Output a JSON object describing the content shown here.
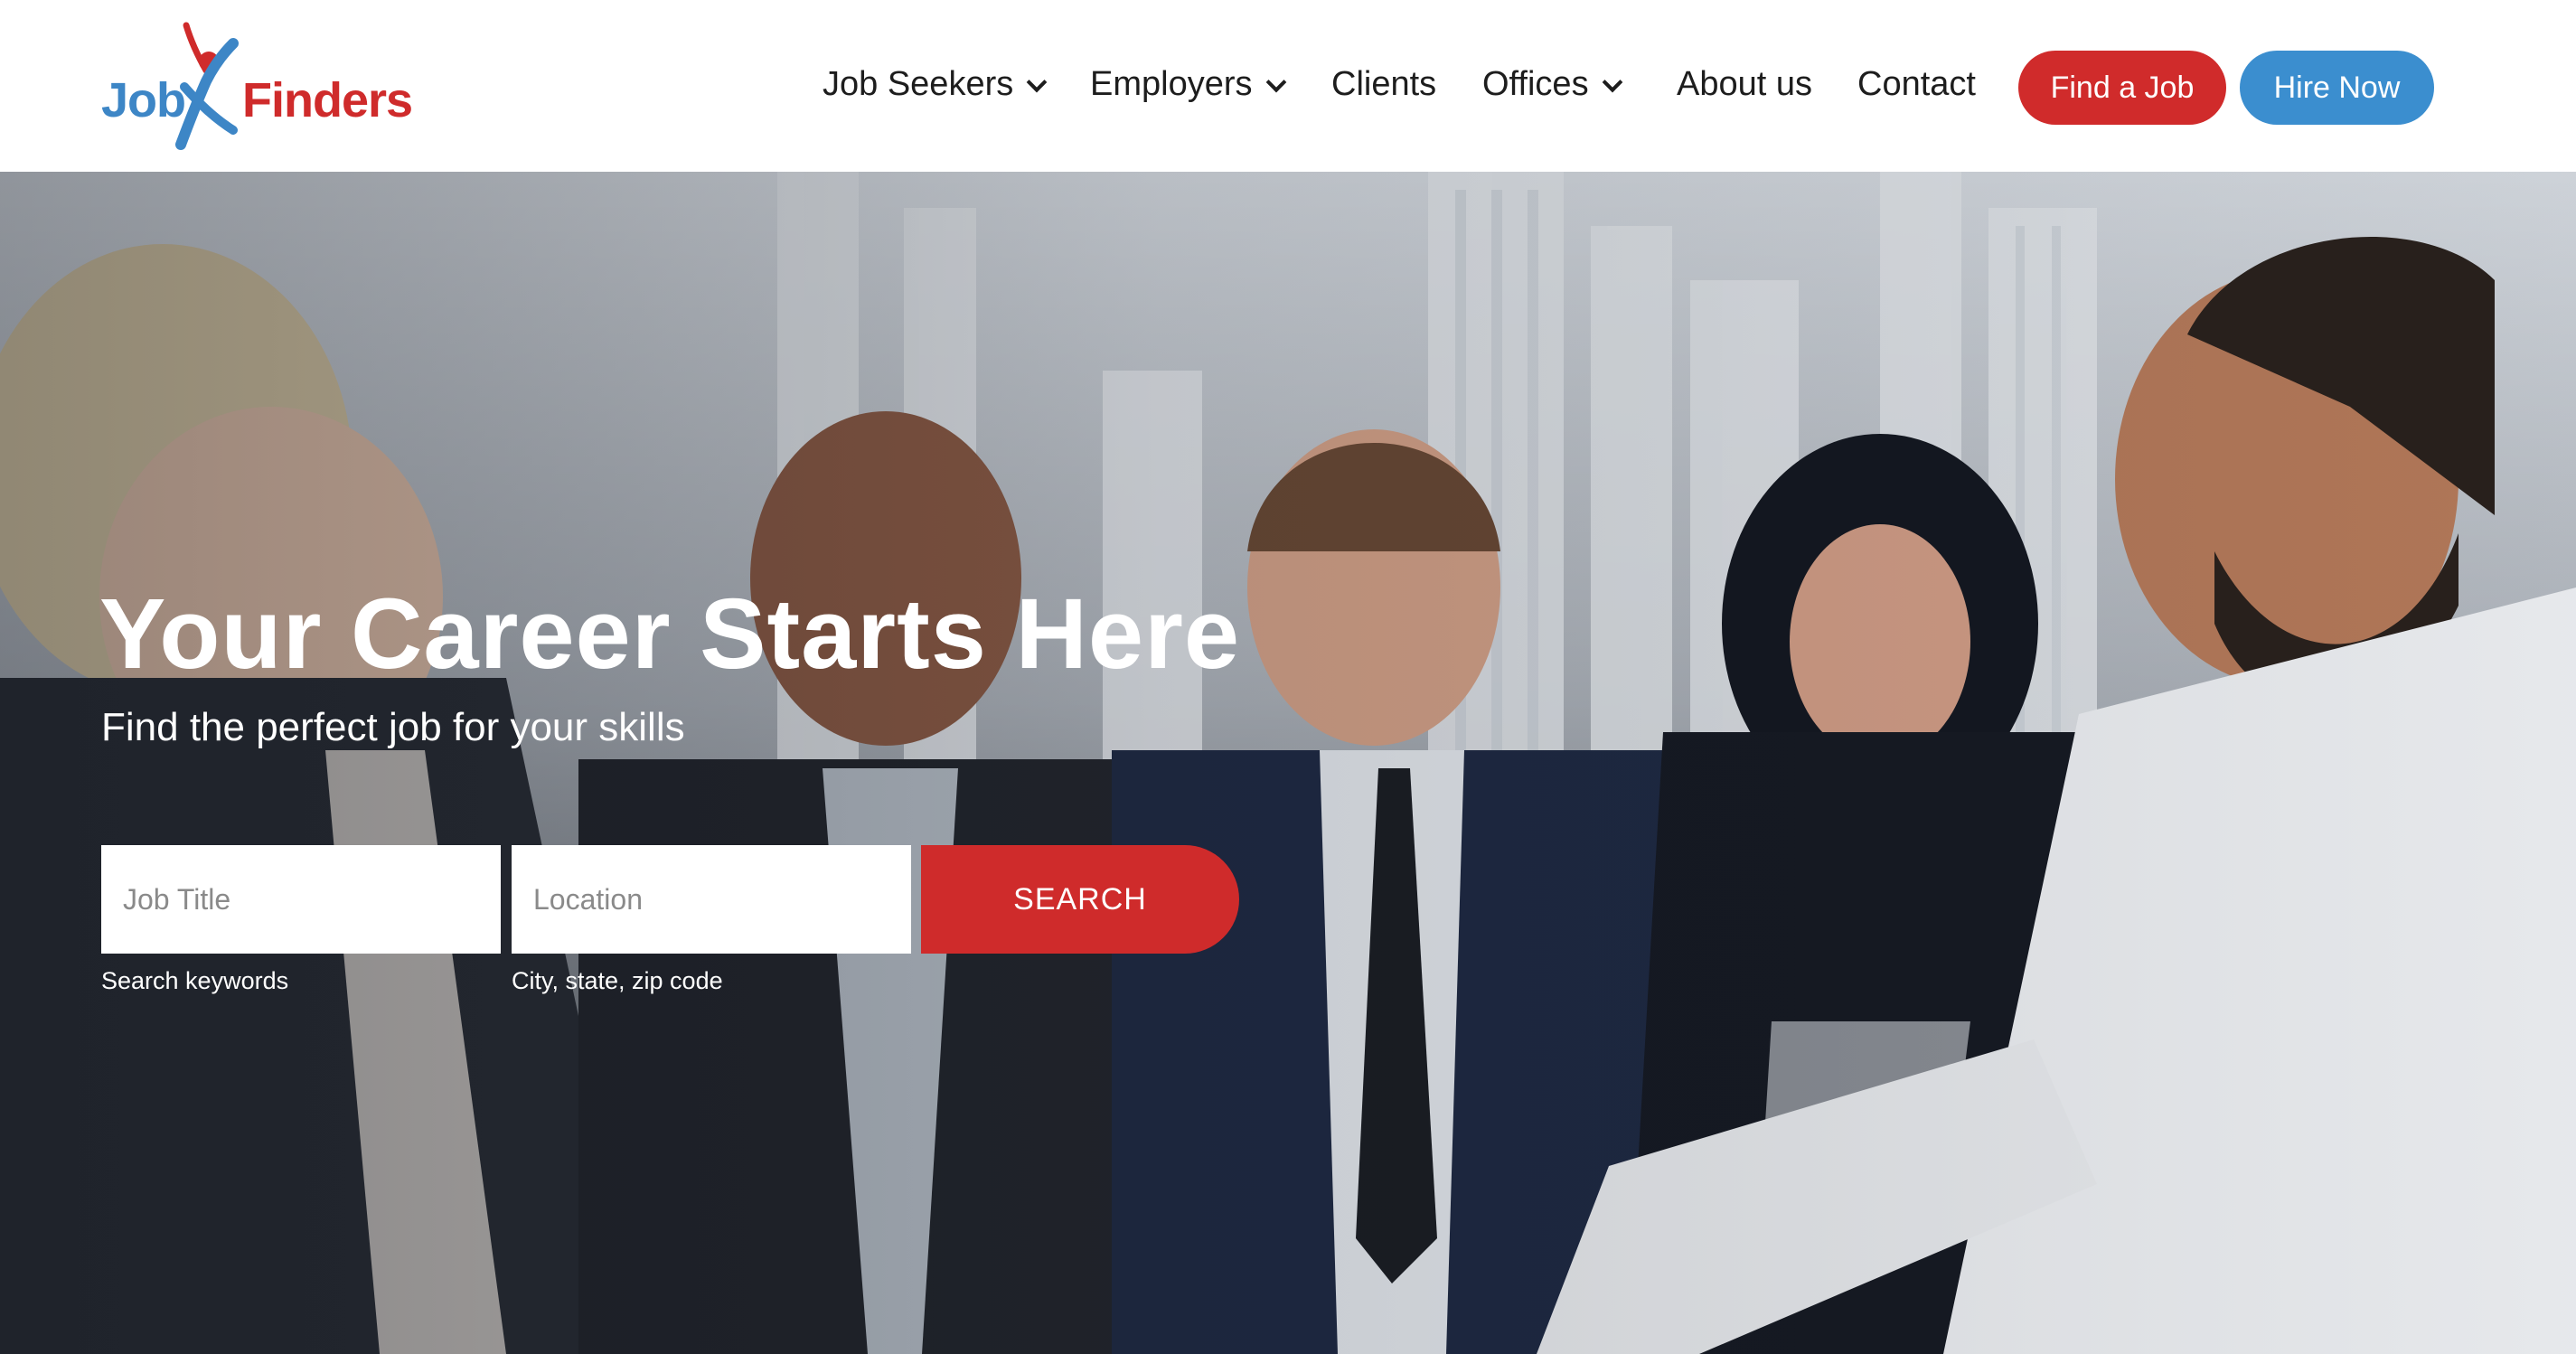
{
  "brand": {
    "logo_text_job": "Job",
    "logo_text_finders": "Finders",
    "colors": {
      "blue": "#3d86c6",
      "red": "#cf2b2b"
    }
  },
  "nav": {
    "items": [
      {
        "label": "Job Seekers",
        "has_dropdown": true
      },
      {
        "label": "Employers",
        "has_dropdown": true
      },
      {
        "label": "Clients",
        "has_dropdown": false
      },
      {
        "label": "Offices",
        "has_dropdown": true
      },
      {
        "label": "About us",
        "has_dropdown": false
      },
      {
        "label": "Contact",
        "has_dropdown": false
      }
    ],
    "find_job_label": "Find a Job",
    "hire_now_label": "Hire Now"
  },
  "hero": {
    "title": "Your Career Starts Here",
    "subtitle": "Find the perfect job for your skills",
    "search": {
      "job_placeholder": "Job Title",
      "job_value": "",
      "job_hint": "Search keywords",
      "location_placeholder": "Location",
      "location_value": "",
      "location_hint": "City, state, zip code",
      "button_label": "SEARCH"
    },
    "background_description_icon": "team-photo"
  }
}
